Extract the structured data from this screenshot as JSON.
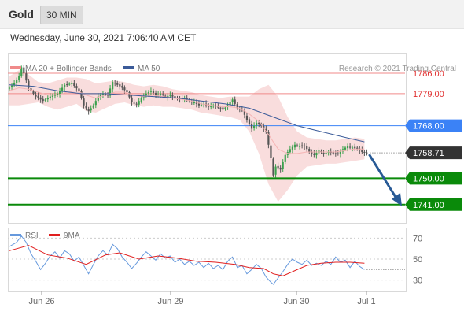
{
  "header": {
    "asset": "Gold",
    "timeframe": "30 MIN",
    "timestamp": "Wednesday, June 30, 2021 7:06:40 AM CET"
  },
  "legend": {
    "bollinger": {
      "label": "MA 20 + Bollinger Bands",
      "color": "#f08a8a"
    },
    "ma50": {
      "label": "MA 50",
      "color": "#3b5b99"
    },
    "credit": "Research © 2021 Trading Central"
  },
  "rsi_legend": {
    "rsi": {
      "label": "RSI",
      "color": "#6699dd"
    },
    "ma9": {
      "label": "9MA",
      "color": "#e01f1f"
    }
  },
  "colors": {
    "up": "#3aa14d",
    "down": "#555555",
    "resistance": "#f08a8a",
    "pivot": "#3b82f6",
    "support": "#0a8a0a",
    "arrow": "#285a96",
    "band_fill": "#f8d4d4"
  },
  "chart_data": [
    {
      "type": "candlestick",
      "ylim": [
        1735,
        1793
      ],
      "x_ticks": [
        "Jun 26",
        "Jun 29",
        "Jun 30",
        "Jul 1"
      ],
      "levels": [
        {
          "label": "1786.00",
          "value": 1786.0,
          "kind": "resistance"
        },
        {
          "label": "1779.00",
          "value": 1779.0,
          "kind": "resistance"
        },
        {
          "label": "1768.00",
          "value": 1768.0,
          "kind": "pivot"
        },
        {
          "label": "1758.71",
          "value": 1758.71,
          "kind": "last"
        },
        {
          "label": "1750.00",
          "value": 1750.0,
          "kind": "support"
        },
        {
          "label": "1741.00",
          "value": 1741.0,
          "kind": "support"
        }
      ],
      "path_points": [
        [
          0,
          1781
        ],
        [
          2,
          1782.5
        ],
        [
          4,
          1785
        ],
        [
          5,
          1788
        ],
        [
          6,
          1786
        ],
        [
          8,
          1781
        ],
        [
          11,
          1778
        ],
        [
          14,
          1776.5
        ],
        [
          17,
          1778
        ],
        [
          20,
          1779
        ],
        [
          23,
          1782
        ],
        [
          26,
          1782.5
        ],
        [
          29,
          1780
        ],
        [
          31,
          1775
        ],
        [
          33,
          1773
        ],
        [
          35,
          1775
        ],
        [
          37,
          1778
        ],
        [
          39,
          1779
        ],
        [
          41,
          1778.5
        ],
        [
          43,
          1783
        ],
        [
          45,
          1782
        ],
        [
          47,
          1781
        ],
        [
          49,
          1779.5
        ],
        [
          51,
          1776
        ],
        [
          53,
          1775.5
        ],
        [
          55,
          1777.5
        ],
        [
          57,
          1779
        ],
        [
          59,
          1780
        ],
        [
          61,
          1778.5
        ],
        [
          63,
          1779
        ],
        [
          65,
          1778
        ],
        [
          67,
          1778.5
        ],
        [
          69,
          1777.5
        ],
        [
          71,
          1777
        ],
        [
          73,
          1777.5
        ],
        [
          75,
          1776.5
        ],
        [
          77,
          1776
        ],
        [
          79,
          1775
        ],
        [
          81,
          1775.5
        ],
        [
          83,
          1774.5
        ],
        [
          85,
          1775
        ],
        [
          87,
          1774.5
        ],
        [
          89,
          1773.5
        ],
        [
          91,
          1775
        ],
        [
          93,
          1777
        ],
        [
          95,
          1774
        ],
        [
          97,
          1773.5
        ],
        [
          99,
          1770
        ],
        [
          101,
          1767
        ],
        [
          103,
          1769
        ],
        [
          105,
          1768
        ],
        [
          107,
          1766
        ],
        [
          109,
          1757
        ],
        [
          110,
          1751
        ],
        [
          111,
          1754
        ],
        [
          113,
          1753
        ],
        [
          115,
          1758
        ],
        [
          117,
          1760
        ],
        [
          119,
          1761.5
        ],
        [
          121,
          1761
        ],
        [
          123,
          1761
        ],
        [
          125,
          1759
        ],
        [
          127,
          1758
        ],
        [
          129,
          1759.5
        ],
        [
          131,
          1758.5
        ],
        [
          133,
          1759
        ],
        [
          135,
          1758.5
        ],
        [
          137,
          1758.5
        ],
        [
          139,
          1760
        ],
        [
          141,
          1761
        ],
        [
          143,
          1760.5
        ],
        [
          145,
          1760
        ],
        [
          147,
          1759
        ],
        [
          149,
          1758.71
        ]
      ],
      "ma20": [
        [
          0,
          1780
        ],
        [
          4,
          1781
        ],
        [
          8,
          1780.5
        ],
        [
          12,
          1779.5
        ],
        [
          16,
          1778.5
        ],
        [
          20,
          1778.5
        ],
        [
          24,
          1779.5
        ],
        [
          28,
          1780
        ],
        [
          32,
          1778.5
        ],
        [
          36,
          1777.5
        ],
        [
          40,
          1778.5
        ],
        [
          44,
          1779.5
        ],
        [
          48,
          1779.5
        ],
        [
          52,
          1778.5
        ],
        [
          56,
          1778
        ],
        [
          60,
          1778.5
        ],
        [
          64,
          1778
        ],
        [
          68,
          1777.5
        ],
        [
          72,
          1777
        ],
        [
          76,
          1776.5
        ],
        [
          80,
          1775.5
        ],
        [
          84,
          1775
        ],
        [
          88,
          1774.5
        ],
        [
          92,
          1774.5
        ],
        [
          96,
          1774
        ],
        [
          100,
          1772
        ],
        [
          104,
          1769.5
        ],
        [
          108,
          1765
        ],
        [
          112,
          1760
        ],
        [
          116,
          1758.5
        ],
        [
          120,
          1758.5
        ],
        [
          124,
          1759
        ],
        [
          128,
          1759
        ],
        [
          132,
          1759
        ],
        [
          136,
          1759
        ],
        [
          140,
          1759.5
        ],
        [
          144,
          1760
        ],
        [
          148,
          1760
        ]
      ],
      "band_upper": [
        [
          0,
          1785
        ],
        [
          4,
          1787
        ],
        [
          8,
          1785.5
        ],
        [
          12,
          1783
        ],
        [
          16,
          1782.5
        ],
        [
          20,
          1783.5
        ],
        [
          24,
          1784.5
        ],
        [
          28,
          1784.5
        ],
        [
          32,
          1784
        ],
        [
          36,
          1782.5
        ],
        [
          40,
          1783
        ],
        [
          44,
          1783.5
        ],
        [
          48,
          1783
        ],
        [
          52,
          1782
        ],
        [
          56,
          1781.5
        ],
        [
          60,
          1782
        ],
        [
          64,
          1781.5
        ],
        [
          68,
          1780.5
        ],
        [
          72,
          1780
        ],
        [
          76,
          1779.5
        ],
        [
          80,
          1778.5
        ],
        [
          84,
          1778
        ],
        [
          88,
          1777.5
        ],
        [
          92,
          1778
        ],
        [
          96,
          1778
        ],
        [
          100,
          1778
        ],
        [
          104,
          1780.5
        ],
        [
          108,
          1782
        ],
        [
          112,
          1778
        ],
        [
          116,
          1771
        ],
        [
          120,
          1766
        ],
        [
          124,
          1764
        ],
        [
          128,
          1763.5
        ],
        [
          132,
          1763
        ],
        [
          136,
          1763
        ],
        [
          140,
          1763.5
        ],
        [
          144,
          1764
        ],
        [
          148,
          1763.5
        ]
      ],
      "band_lower": [
        [
          0,
          1775
        ],
        [
          4,
          1775
        ],
        [
          8,
          1775.5
        ],
        [
          12,
          1776
        ],
        [
          16,
          1774.5
        ],
        [
          20,
          1773.5
        ],
        [
          24,
          1774.5
        ],
        [
          28,
          1775.5
        ],
        [
          32,
          1773
        ],
        [
          36,
          1772.5
        ],
        [
          40,
          1774
        ],
        [
          44,
          1775.5
        ],
        [
          48,
          1776
        ],
        [
          52,
          1775
        ],
        [
          56,
          1774.5
        ],
        [
          60,
          1775
        ],
        [
          64,
          1774.5
        ],
        [
          68,
          1774.5
        ],
        [
          72,
          1774
        ],
        [
          76,
          1773.5
        ],
        [
          80,
          1772.5
        ],
        [
          84,
          1772
        ],
        [
          88,
          1771.5
        ],
        [
          92,
          1771
        ],
        [
          96,
          1770
        ],
        [
          100,
          1766
        ],
        [
          104,
          1758.5
        ],
        [
          108,
          1748
        ],
        [
          112,
          1742
        ],
        [
          116,
          1746
        ],
        [
          120,
          1751
        ],
        [
          124,
          1754
        ],
        [
          128,
          1754.5
        ],
        [
          132,
          1755
        ],
        [
          136,
          1755
        ],
        [
          140,
          1755.5
        ],
        [
          144,
          1756
        ],
        [
          148,
          1756.5
        ]
      ],
      "ma50": [
        [
          0,
          1782
        ],
        [
          10,
          1781.5
        ],
        [
          20,
          1780
        ],
        [
          30,
          1779
        ],
        [
          40,
          1779
        ],
        [
          50,
          1778.5
        ],
        [
          60,
          1778
        ],
        [
          70,
          1777.5
        ],
        [
          80,
          1776.5
        ],
        [
          90,
          1775.5
        ],
        [
          100,
          1774
        ],
        [
          110,
          1771
        ],
        [
          120,
          1768
        ],
        [
          130,
          1766
        ],
        [
          140,
          1764
        ],
        [
          148,
          1762.5
        ]
      ]
    },
    {
      "type": "line",
      "title": "RSI",
      "ylim": [
        20,
        80
      ],
      "y_ticks": [
        "70",
        "50",
        "30"
      ],
      "y_tick_values": [
        70,
        50,
        30
      ],
      "rsi_points": [
        [
          0,
          62
        ],
        [
          3,
          66
        ],
        [
          5,
          72
        ],
        [
          7,
          66
        ],
        [
          9,
          55
        ],
        [
          11,
          48
        ],
        [
          13,
          40
        ],
        [
          15,
          46
        ],
        [
          17,
          53
        ],
        [
          19,
          57
        ],
        [
          21,
          51
        ],
        [
          23,
          58
        ],
        [
          25,
          55
        ],
        [
          27,
          48
        ],
        [
          29,
          52
        ],
        [
          31,
          44
        ],
        [
          33,
          36
        ],
        [
          35,
          45
        ],
        [
          37,
          53
        ],
        [
          39,
          58
        ],
        [
          41,
          54
        ],
        [
          43,
          64
        ],
        [
          45,
          60
        ],
        [
          47,
          52
        ],
        [
          49,
          47
        ],
        [
          51,
          41
        ],
        [
          53,
          46
        ],
        [
          55,
          52
        ],
        [
          57,
          57
        ],
        [
          59,
          53
        ],
        [
          61,
          49
        ],
        [
          63,
          55
        ],
        [
          65,
          51
        ],
        [
          67,
          53
        ],
        [
          69,
          47
        ],
        [
          71,
          50
        ],
        [
          73,
          45
        ],
        [
          75,
          48
        ],
        [
          77,
          44
        ],
        [
          79,
          47
        ],
        [
          81,
          42
        ],
        [
          83,
          46
        ],
        [
          85,
          41
        ],
        [
          87,
          44
        ],
        [
          89,
          40
        ],
        [
          91,
          48
        ],
        [
          93,
          52
        ],
        [
          95,
          42
        ],
        [
          97,
          44
        ],
        [
          99,
          36
        ],
        [
          101,
          40
        ],
        [
          103,
          45
        ],
        [
          105,
          41
        ],
        [
          107,
          33
        ],
        [
          109,
          28
        ],
        [
          110,
          26
        ],
        [
          112,
          32
        ],
        [
          114,
          38
        ],
        [
          116,
          45
        ],
        [
          118,
          50
        ],
        [
          120,
          47
        ],
        [
          122,
          45
        ],
        [
          124,
          49
        ],
        [
          126,
          44
        ],
        [
          128,
          46
        ],
        [
          130,
          44
        ],
        [
          132,
          48
        ],
        [
          134,
          45
        ],
        [
          136,
          52
        ],
        [
          138,
          47
        ],
        [
          140,
          49
        ],
        [
          142,
          42
        ],
        [
          144,
          48
        ],
        [
          146,
          43
        ],
        [
          148,
          40
        ]
      ],
      "ma9_points": [
        [
          0,
          58
        ],
        [
          8,
          63
        ],
        [
          16,
          54
        ],
        [
          24,
          51
        ],
        [
          32,
          45
        ],
        [
          40,
          54
        ],
        [
          46,
          56
        ],
        [
          54,
          50
        ],
        [
          62,
          53
        ],
        [
          70,
          51
        ],
        [
          78,
          48
        ],
        [
          86,
          47
        ],
        [
          94,
          45
        ],
        [
          100,
          42
        ],
        [
          106,
          41
        ],
        [
          110,
          36
        ],
        [
          114,
          34
        ],
        [
          118,
          38
        ],
        [
          124,
          44
        ],
        [
          130,
          46
        ],
        [
          136,
          47
        ],
        [
          142,
          47
        ],
        [
          148,
          46
        ]
      ]
    }
  ]
}
